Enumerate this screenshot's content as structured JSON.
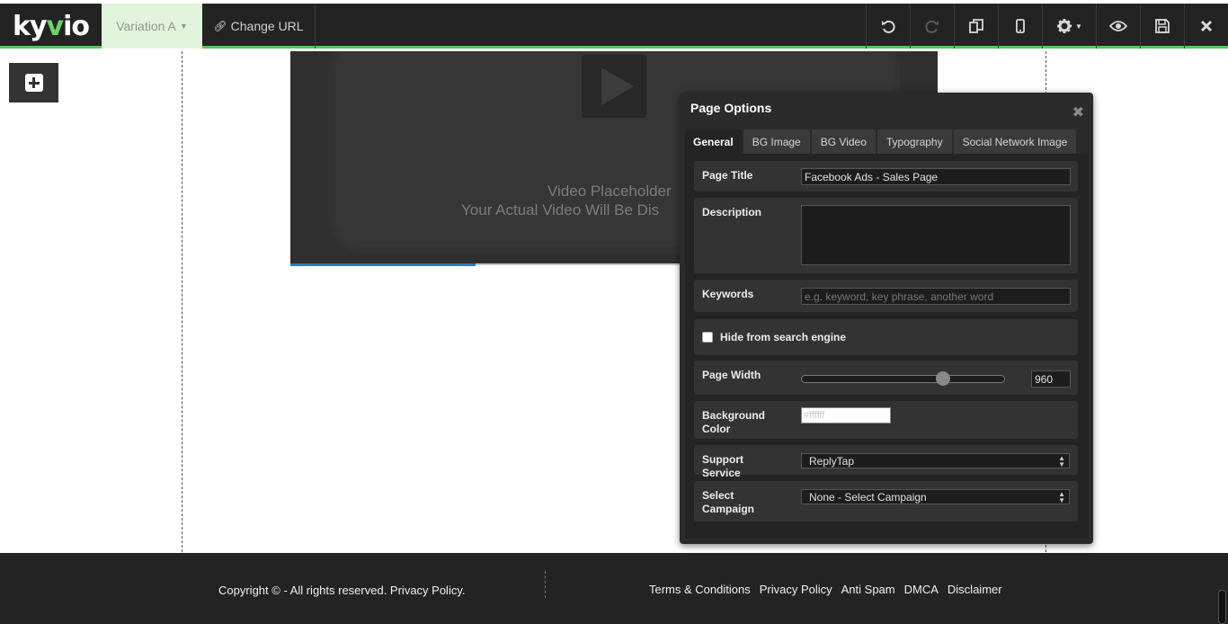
{
  "toolbar": {
    "logo_prefix": "ky",
    "logo_v": "v",
    "logo_suffix": "io",
    "variation_label": "Variation A",
    "change_url_label": "Change URL",
    "icons": [
      "undo-icon",
      "redo-icon",
      "copy-icon",
      "mobile-icon",
      "gear-icon",
      "eye-icon",
      "save-icon",
      "close-icon"
    ]
  },
  "video": {
    "line1": "Video Placeholder",
    "line2": "Your Actual Video Will Be Dis",
    "progress": 0.286
  },
  "modal": {
    "title": "Page Options",
    "tabs": [
      "General",
      "BG Image",
      "BG Video",
      "Typography",
      "Social Network Image"
    ],
    "active_tab": "General",
    "page_title": {
      "label": "Page Title",
      "value": "Facebook Ads - Sales Page"
    },
    "description": {
      "label": "Description",
      "value": ""
    },
    "keywords": {
      "label": "Keywords",
      "placeholder": "e.g. keyword, key phrase, another word"
    },
    "hide_search": {
      "label": "Hide from search engine",
      "checked": false
    },
    "page_width": {
      "label": "Page Width",
      "value": "960"
    },
    "background_color": {
      "label": "Background Color",
      "value": "#ffffff"
    },
    "support_service": {
      "label": "Support Service",
      "value": "ReplyTap"
    },
    "campaign": {
      "label": "Select Campaign",
      "value": "None - Select Campaign"
    }
  },
  "footer": {
    "copyright": "Copyright © - All rights reserved. Privacy Policy.",
    "links": [
      "Terms & Conditions",
      "Privacy Policy",
      "Anti Spam",
      "DMCA",
      "Disclaimer"
    ]
  },
  "colors": {
    "toolbar_bg": "#232323",
    "accent": "#5cc35a",
    "variation_bg": "#e2f3dc",
    "modal_bg": "#2b2b2b",
    "video_progress": "#2a7fc0"
  }
}
